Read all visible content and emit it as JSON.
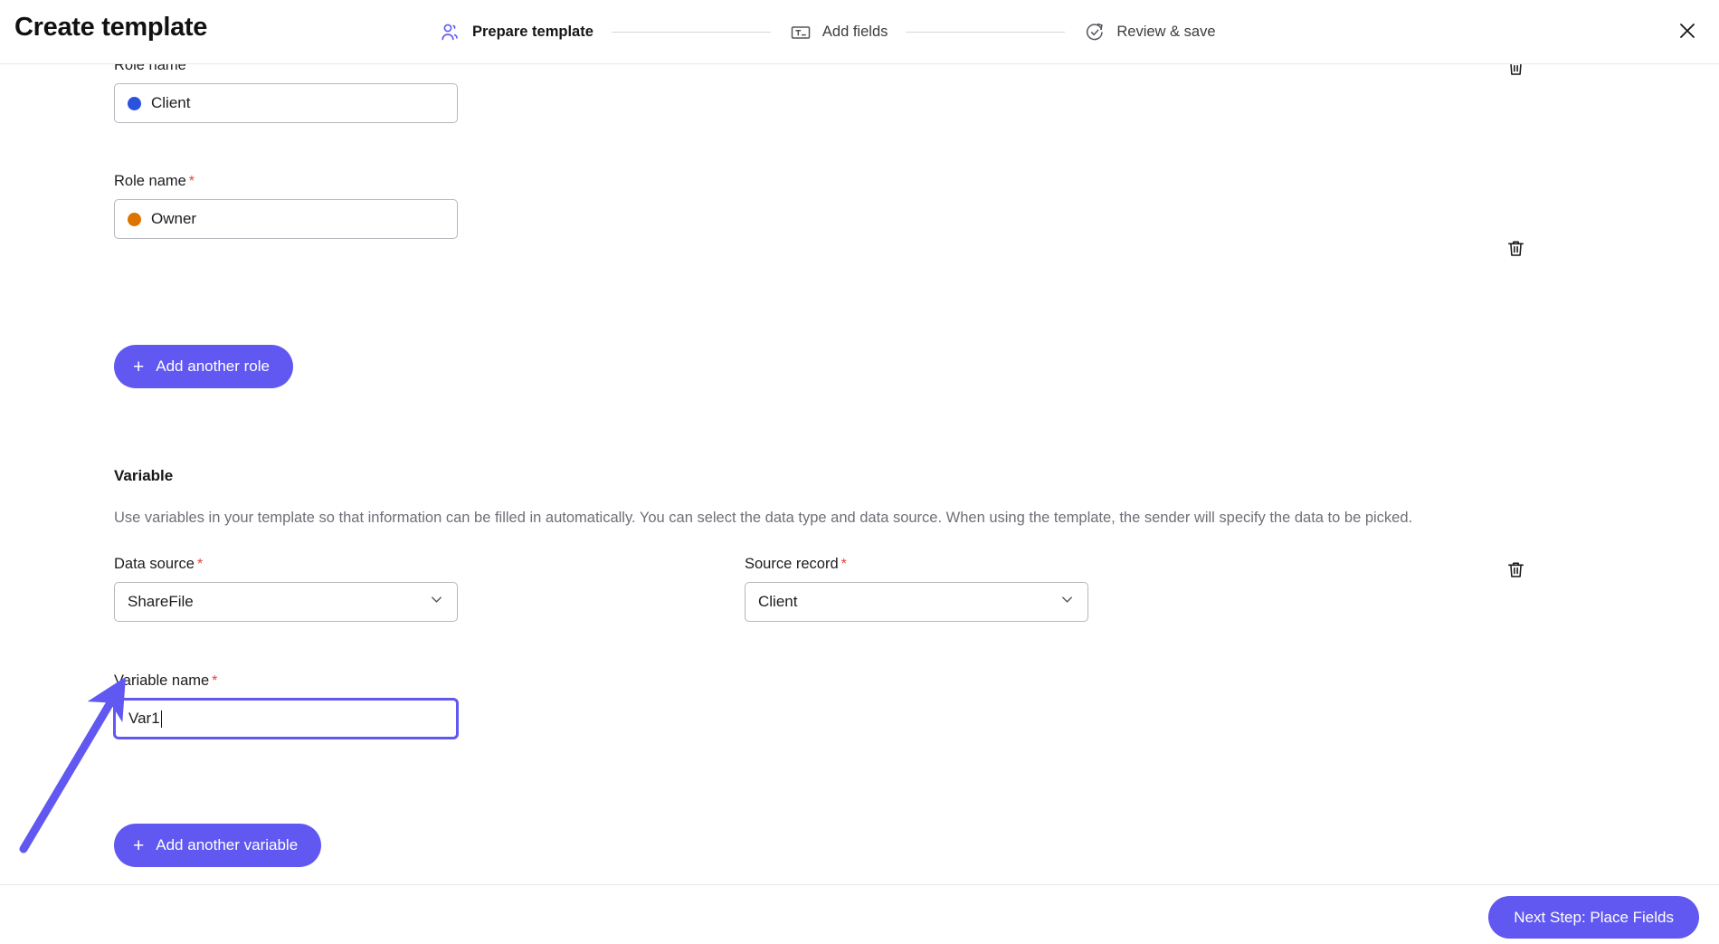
{
  "header": {
    "title": "Create template",
    "close_icon": "close-icon",
    "steps": [
      {
        "label": "Prepare template",
        "icon": "users-icon",
        "active": true
      },
      {
        "label": "Add fields",
        "icon": "text-field-icon",
        "active": false
      },
      {
        "label": "Review & save",
        "icon": "check-circle-arrow-icon",
        "active": false
      }
    ]
  },
  "roles": {
    "label_clipped": "Role name",
    "items": [
      {
        "label": "Role name",
        "value": "Client",
        "dot_color": "#2a52de",
        "delete_icon": "trash-icon"
      },
      {
        "label": "Role name",
        "value": "Owner",
        "dot_color": "#dd7400",
        "delete_icon": "trash-icon"
      }
    ],
    "add_button": {
      "label": "Add another role",
      "plus": "+"
    }
  },
  "variable_section": {
    "title": "Variable",
    "description": "Use variables in your template so that information can be filled in automatically. You can select the data type and data source. When using the template, the sender will specify the data to be picked.",
    "data_source": {
      "label": "Data source",
      "required": "*",
      "value": "ShareFile",
      "chevron_icon": "chevron-down-icon"
    },
    "source_record": {
      "label": "Source record",
      "required": "*",
      "value": "Client",
      "chevron_icon": "chevron-down-icon"
    },
    "variable_name": {
      "label": "Variable name",
      "required": "*",
      "value": "Var1",
      "focused": true
    },
    "delete_icon": "trash-icon",
    "add_button": {
      "label": "Add another variable",
      "plus": "+"
    }
  },
  "footer": {
    "next_button": "Next Step: Place Fields"
  },
  "colors": {
    "accent": "#6058f0",
    "required": "#e0443e",
    "role_client": "#2a52de",
    "role_owner": "#dd7400",
    "annotation_arrow": "#6058f0"
  }
}
